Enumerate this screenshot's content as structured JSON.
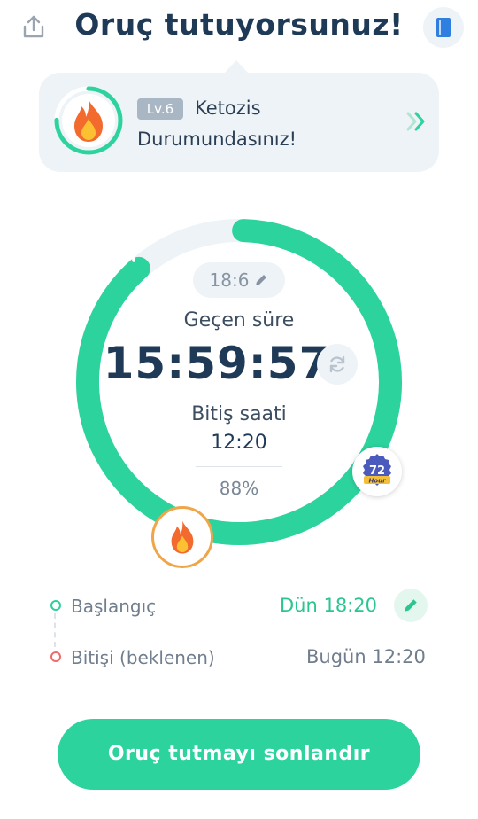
{
  "header": {
    "title": "Oruç tutuyorsunuz!",
    "share_icon": "share-icon",
    "book_icon": "book-icon"
  },
  "status": {
    "level": "Lv.6",
    "line1": "Ketozis",
    "line2": "Durumundasınız!",
    "icon": "fire-icon"
  },
  "timer": {
    "plan": "18:6",
    "elapsed_label": "Geçen süre",
    "elapsed": "15:59:57",
    "end_label": "Bitiş saati",
    "end_time": "12:20",
    "percent": "88%",
    "progress": 0.88,
    "badge_number": "72",
    "badge_caption": "Hour"
  },
  "schedule": {
    "start_label": "Başlangıç",
    "start_value": "Dün 18:20",
    "end_label": "Bitişi (beklenen)",
    "end_value": "Bugün 12:20"
  },
  "actions": {
    "end_fast": "Oruç tutmayı sonlandır"
  },
  "colors": {
    "accent": "#2dd39d",
    "track": "#eef3f7",
    "title": "#1f3a56",
    "fire": "#f26a2e"
  }
}
